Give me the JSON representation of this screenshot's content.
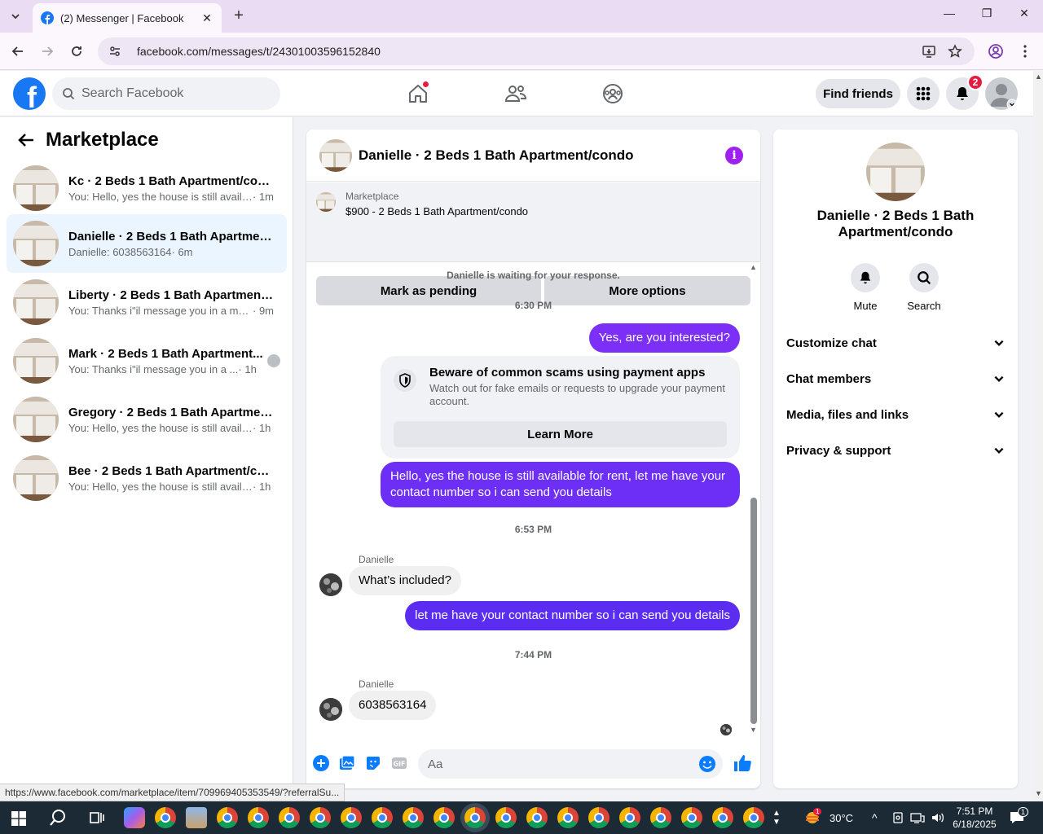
{
  "browser": {
    "tab_title": "(2) Messenger | Facebook",
    "url": "facebook.com/messages/t/24301003596152840",
    "status_url": "https://www.facebook.com/marketplace/item/709969405353549/?referralSu..."
  },
  "fb": {
    "search_placeholder": "Search Facebook",
    "find_friends": "Find friends",
    "notifications_count": "2"
  },
  "sidebar": {
    "title": "Marketplace",
    "conversations": [
      {
        "name": "Kc · 2 Beds 1 Bath Apartment/condo",
        "preview": "You: Hello, yes the house is still availa...",
        "time": "· 1m"
      },
      {
        "name": "Danielle · 2 Beds 1 Bath Apartment...",
        "preview": "Danielle: 6038563164",
        "time": "· 6m"
      },
      {
        "name": "Liberty · 2 Beds 1 Bath Apartment/...",
        "preview": "You: Thanks i\"il message you in a mo...",
        "time": "· 9m"
      },
      {
        "name": "Mark · 2 Beds 1 Bath Apartment...",
        "preview": "You: Thanks i\"il message you in a ...",
        "time": "· 1h"
      },
      {
        "name": "Gregory · 2 Beds 1 Bath Apartment...",
        "preview": "You: Hello, yes the house is still availa...",
        "time": "· 1h"
      },
      {
        "name": "Bee · 2 Beds 1 Bath Apartment/co...",
        "preview": "You: Hello, yes the house is still availa...",
        "time": "· 1h"
      }
    ]
  },
  "chat": {
    "title": "Danielle · 2 Beds 1 Bath Apartment/condo",
    "marketplace_label": "Marketplace",
    "listing": "$900 - 2 Beds 1 Bath Apartment/condo",
    "mark_pending": "Mark as pending",
    "more_options": "More options",
    "waiting": "Danielle is waiting for your response.",
    "time1": "6:30 PM",
    "out1": "Yes, are you interested?",
    "warn_title": "Beware of common scams using payment apps",
    "warn_desc": "Watch out for fake emails or requests to upgrade your payment account.",
    "learn_more": "Learn More",
    "out2": "Hello, yes the house is still available for rent, let me have your contact number so i can send you details",
    "time2": "6:53 PM",
    "sender": "Danielle",
    "in1": "What’s included?",
    "out3": "let me have your contact number so i can send you details",
    "time3": "7:44 PM",
    "in2": "6038563164",
    "composer_placeholder": "Aa"
  },
  "info_panel": {
    "name": "Danielle · 2 Beds 1 Bath Apartment/condo",
    "mute": "Mute",
    "search": "Search",
    "sections": [
      "Customize chat",
      "Chat members",
      "Media, files and links",
      "Privacy & support"
    ]
  },
  "taskbar": {
    "weather": "30°C",
    "time": "7:51 PM",
    "date": "6/18/2025",
    "notif_count": "1"
  },
  "colors": {
    "fb_blue": "#1877f2",
    "outgoing_bubble": "#7b2ff7",
    "active_row": "#ebf5ff",
    "badge_red": "#e41e3f"
  }
}
